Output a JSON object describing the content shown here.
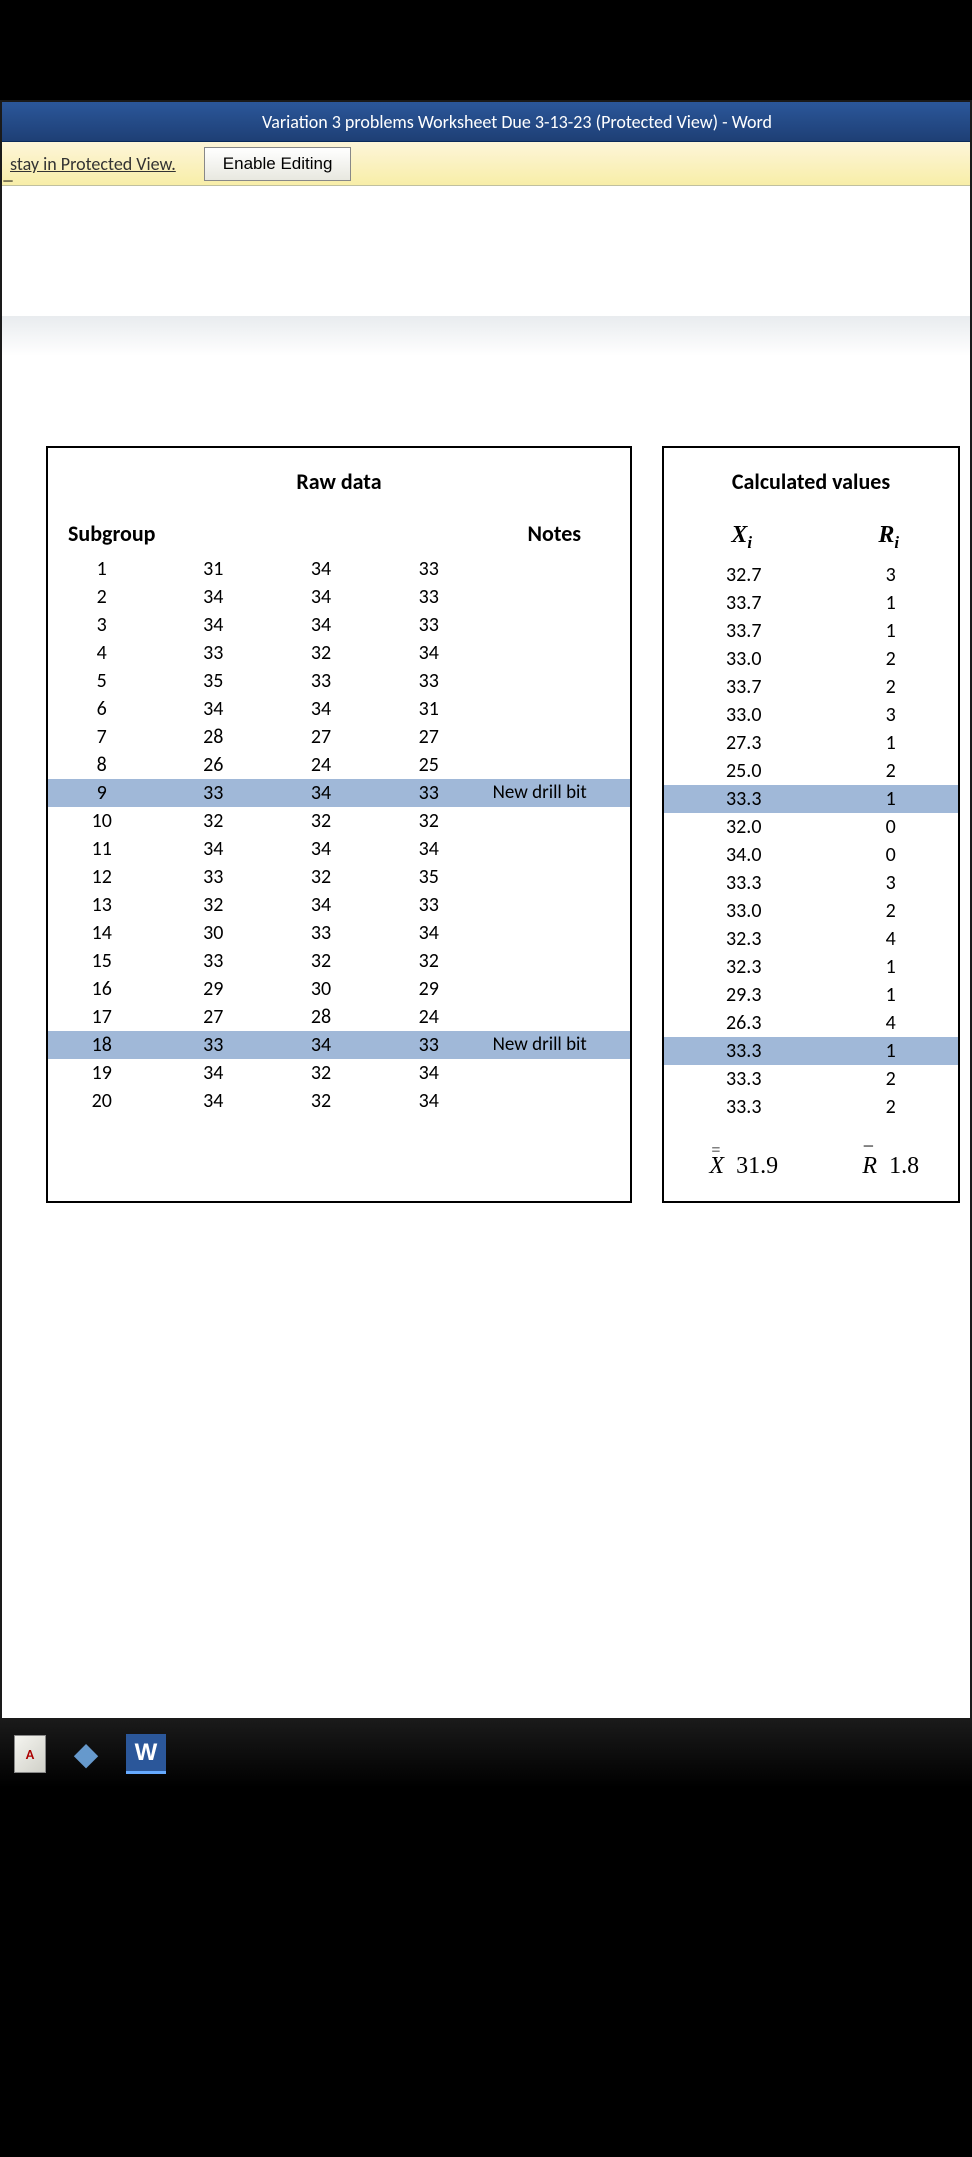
{
  "titlebar": "Variation 3 problems Worksheet Due 3-13-23 (Protected View)  -  Word",
  "protected": {
    "link": "stay in Protected View.",
    "button": "Enable Editing"
  },
  "raw_table": {
    "title": "Raw data",
    "subgroup_h": "Subgroup",
    "notes_h": "Notes",
    "rows": [
      {
        "n": "1",
        "a": "31",
        "b": "34",
        "c": "33",
        "note": ""
      },
      {
        "n": "2",
        "a": "34",
        "b": "34",
        "c": "33",
        "note": ""
      },
      {
        "n": "3",
        "a": "34",
        "b": "34",
        "c": "33",
        "note": ""
      },
      {
        "n": "4",
        "a": "33",
        "b": "32",
        "c": "34",
        "note": ""
      },
      {
        "n": "5",
        "a": "35",
        "b": "33",
        "c": "33",
        "note": ""
      },
      {
        "n": "6",
        "a": "34",
        "b": "34",
        "c": "31",
        "note": ""
      },
      {
        "n": "7",
        "a": "28",
        "b": "27",
        "c": "27",
        "note": ""
      },
      {
        "n": "8",
        "a": "26",
        "b": "24",
        "c": "25",
        "note": ""
      },
      {
        "n": "9",
        "a": "33",
        "b": "34",
        "c": "33",
        "note": "New drill bit",
        "hl": true
      },
      {
        "n": "10",
        "a": "32",
        "b": "32",
        "c": "32",
        "note": ""
      },
      {
        "n": "11",
        "a": "34",
        "b": "34",
        "c": "34",
        "note": ""
      },
      {
        "n": "12",
        "a": "33",
        "b": "32",
        "c": "35",
        "note": ""
      },
      {
        "n": "13",
        "a": "32",
        "b": "34",
        "c": "33",
        "note": ""
      },
      {
        "n": "14",
        "a": "30",
        "b": "33",
        "c": "34",
        "note": ""
      },
      {
        "n": "15",
        "a": "33",
        "b": "32",
        "c": "32",
        "note": ""
      },
      {
        "n": "16",
        "a": "29",
        "b": "30",
        "c": "29",
        "note": ""
      },
      {
        "n": "17",
        "a": "27",
        "b": "28",
        "c": "24",
        "note": ""
      },
      {
        "n": "18",
        "a": "33",
        "b": "34",
        "c": "33",
        "note": "New drill bit",
        "hl": true
      },
      {
        "n": "19",
        "a": "34",
        "b": "32",
        "c": "34",
        "note": ""
      },
      {
        "n": "20",
        "a": "34",
        "b": "32",
        "c": "34",
        "note": ""
      }
    ]
  },
  "calc_table": {
    "title": "Calculated values",
    "xbar_h": "X̄ᵢ",
    "r_h": "Rᵢ",
    "rows": [
      {
        "x": "32.7",
        "r": "3"
      },
      {
        "x": "33.7",
        "r": "1"
      },
      {
        "x": "33.7",
        "r": "1"
      },
      {
        "x": "33.0",
        "r": "2"
      },
      {
        "x": "33.7",
        "r": "2"
      },
      {
        "x": "33.0",
        "r": "3"
      },
      {
        "x": "27.3",
        "r": "1"
      },
      {
        "x": "25.0",
        "r": "2"
      },
      {
        "x": "33.3",
        "r": "1",
        "hl": true
      },
      {
        "x": "32.0",
        "r": "0"
      },
      {
        "x": "34.0",
        "r": "0"
      },
      {
        "x": "33.3",
        "r": "3"
      },
      {
        "x": "33.0",
        "r": "2"
      },
      {
        "x": "32.3",
        "r": "4"
      },
      {
        "x": "32.3",
        "r": "1"
      },
      {
        "x": "29.3",
        "r": "1"
      },
      {
        "x": "26.3",
        "r": "4"
      },
      {
        "x": "33.3",
        "r": "1",
        "hl": true
      },
      {
        "x": "33.3",
        "r": "2"
      },
      {
        "x": "33.3",
        "r": "2"
      }
    ],
    "summary": {
      "xdbar_sym": "X̄̄",
      "xdbar": "31.9",
      "rbar_sym": "R̄",
      "rbar": "1.8"
    }
  },
  "taskbar": {
    "icons": [
      "doc",
      "folder",
      "word"
    ]
  }
}
